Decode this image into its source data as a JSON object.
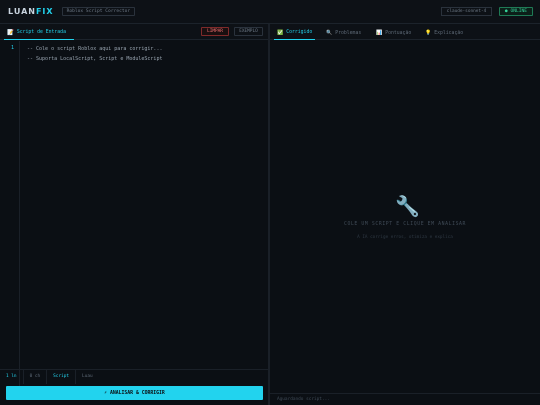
{
  "app": {
    "logo_part1": "LUAN",
    "logo_part2": "FIX",
    "subtitle": "Roblox Script Corrector",
    "model": "claude-sonnet-4",
    "status": "● ONLINE"
  },
  "editor": {
    "tab_icon": "📝",
    "tab_label": "Script de Entrada",
    "clear_label": "LIMPAR",
    "example_label": "EXEMPLO",
    "line_number": "1",
    "lines": [
      "-- Cole o script Roblox aqui para corrigir...",
      "-- Suporta LocalScript, Script e ModuleScript"
    ],
    "status": {
      "lines": "1 ln",
      "chars": "0 ch",
      "type": "Script",
      "lang": "Luau"
    },
    "analyze_label": "⚡ ANALISAR & CORRIGIR"
  },
  "output": {
    "tabs": [
      {
        "icon": "✅",
        "label": "Corrigido"
      },
      {
        "icon": "🔍",
        "label": "Problemas"
      },
      {
        "icon": "📊",
        "label": "Pontuação"
      },
      {
        "icon": "💡",
        "label": "Explicação"
      }
    ],
    "empty_icon": "wrench-icon",
    "empty_title": "COLE UM SCRIPT E CLIQUE EM ANALISAR",
    "empty_sub": "A IA corrige erros, otimiza e explica",
    "status": "Aguardando script..."
  },
  "colors": {
    "accent": "#22d3ee",
    "online": "#34d399",
    "danger": "#f87171",
    "background": "#0a0d11"
  }
}
